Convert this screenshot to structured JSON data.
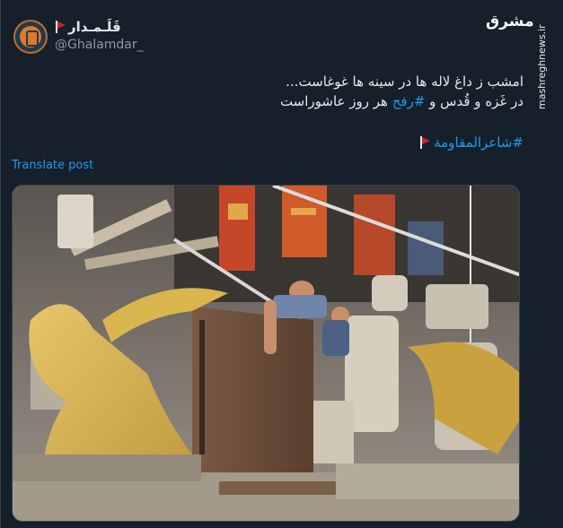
{
  "author": {
    "display_name": "قَلَـمـدار",
    "handle": "@Ghalamdar_"
  },
  "watermark": {
    "logo_text": "مشرق",
    "site": "mashreghnews.ir"
  },
  "tweet": {
    "line1": "امشب ز داغ لاله ها در سینه ها غوغاست...",
    "line2_pre": "در غَزه و قُدس و ",
    "line2_hashtag": "#رفح",
    "line2_post": " هر روز عاشوراست",
    "hashtag": "#شاعرالمقاومة"
  },
  "translate_label": "Translate post",
  "colors": {
    "background": "#15202b",
    "link": "#1d9bf0",
    "text": "#e7e9ea",
    "muted": "#8b98a5"
  },
  "media": {
    "icon": "photo-rubble-rescue"
  }
}
